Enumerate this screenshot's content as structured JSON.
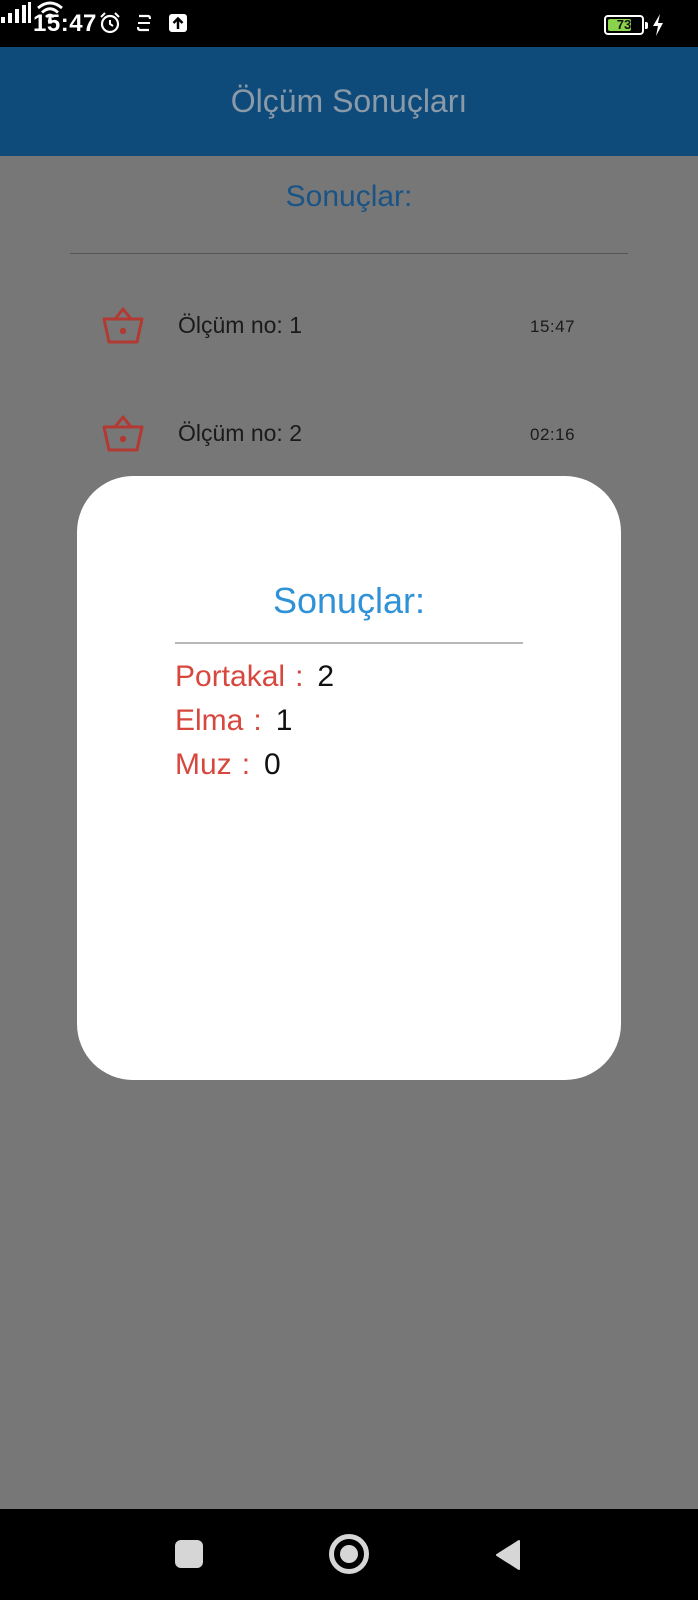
{
  "status_bar": {
    "time": "15:47",
    "battery_level": "73",
    "battery_fraction": 0.73,
    "icons": [
      "alarm-icon",
      "sync-icon",
      "upload-icon",
      "signal-icon",
      "wifi-icon",
      "battery-icon",
      "charging-icon"
    ]
  },
  "app_bar": {
    "title": "Ölçüm Sonuçları"
  },
  "content": {
    "heading": "Sonuçlar:",
    "items": [
      {
        "label": "Ölçüm no: 1",
        "time": "15:47",
        "icon": "basket-icon"
      },
      {
        "label": "Ölçüm no: 2",
        "time": "02:16",
        "icon": "basket-icon"
      }
    ]
  },
  "dialog": {
    "title": "Sonuçlar:",
    "separator": ":",
    "results": [
      {
        "label": "Portakal",
        "value": "2"
      },
      {
        "label": "Elma",
        "value": "1"
      },
      {
        "label": "Muz",
        "value": "0"
      }
    ]
  },
  "nav_bar": {
    "icons": [
      "recent-apps-icon",
      "home-icon",
      "back-icon"
    ]
  },
  "colors": {
    "app_bar": "#0f4b7a",
    "scrim": "#777777",
    "accent_blue": "#2f92d6",
    "accent_red": "#d8473e"
  }
}
